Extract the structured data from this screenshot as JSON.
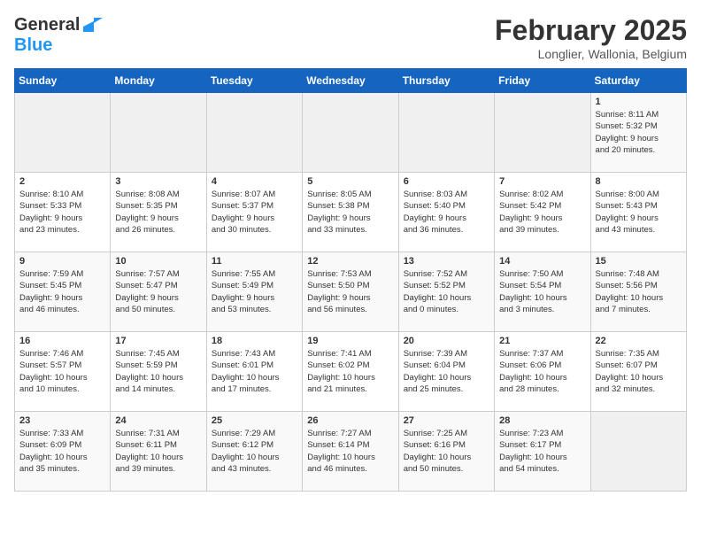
{
  "header": {
    "logo": {
      "general": "General",
      "blue": "Blue"
    },
    "title": "February 2025",
    "location": "Longlier, Wallonia, Belgium"
  },
  "weekdays": [
    "Sunday",
    "Monday",
    "Tuesday",
    "Wednesday",
    "Thursday",
    "Friday",
    "Saturday"
  ],
  "weeks": [
    [
      {
        "day": "",
        "info": ""
      },
      {
        "day": "",
        "info": ""
      },
      {
        "day": "",
        "info": ""
      },
      {
        "day": "",
        "info": ""
      },
      {
        "day": "",
        "info": ""
      },
      {
        "day": "",
        "info": ""
      },
      {
        "day": "1",
        "info": "Sunrise: 8:11 AM\nSunset: 5:32 PM\nDaylight: 9 hours\nand 20 minutes."
      }
    ],
    [
      {
        "day": "2",
        "info": "Sunrise: 8:10 AM\nSunset: 5:33 PM\nDaylight: 9 hours\nand 23 minutes."
      },
      {
        "day": "3",
        "info": "Sunrise: 8:08 AM\nSunset: 5:35 PM\nDaylight: 9 hours\nand 26 minutes."
      },
      {
        "day": "4",
        "info": "Sunrise: 8:07 AM\nSunset: 5:37 PM\nDaylight: 9 hours\nand 30 minutes."
      },
      {
        "day": "5",
        "info": "Sunrise: 8:05 AM\nSunset: 5:38 PM\nDaylight: 9 hours\nand 33 minutes."
      },
      {
        "day": "6",
        "info": "Sunrise: 8:03 AM\nSunset: 5:40 PM\nDaylight: 9 hours\nand 36 minutes."
      },
      {
        "day": "7",
        "info": "Sunrise: 8:02 AM\nSunset: 5:42 PM\nDaylight: 9 hours\nand 39 minutes."
      },
      {
        "day": "8",
        "info": "Sunrise: 8:00 AM\nSunset: 5:43 PM\nDaylight: 9 hours\nand 43 minutes."
      }
    ],
    [
      {
        "day": "9",
        "info": "Sunrise: 7:59 AM\nSunset: 5:45 PM\nDaylight: 9 hours\nand 46 minutes."
      },
      {
        "day": "10",
        "info": "Sunrise: 7:57 AM\nSunset: 5:47 PM\nDaylight: 9 hours\nand 50 minutes."
      },
      {
        "day": "11",
        "info": "Sunrise: 7:55 AM\nSunset: 5:49 PM\nDaylight: 9 hours\nand 53 minutes."
      },
      {
        "day": "12",
        "info": "Sunrise: 7:53 AM\nSunset: 5:50 PM\nDaylight: 9 hours\nand 56 minutes."
      },
      {
        "day": "13",
        "info": "Sunrise: 7:52 AM\nSunset: 5:52 PM\nDaylight: 10 hours\nand 0 minutes."
      },
      {
        "day": "14",
        "info": "Sunrise: 7:50 AM\nSunset: 5:54 PM\nDaylight: 10 hours\nand 3 minutes."
      },
      {
        "day": "15",
        "info": "Sunrise: 7:48 AM\nSunset: 5:56 PM\nDaylight: 10 hours\nand 7 minutes."
      }
    ],
    [
      {
        "day": "16",
        "info": "Sunrise: 7:46 AM\nSunset: 5:57 PM\nDaylight: 10 hours\nand 10 minutes."
      },
      {
        "day": "17",
        "info": "Sunrise: 7:45 AM\nSunset: 5:59 PM\nDaylight: 10 hours\nand 14 minutes."
      },
      {
        "day": "18",
        "info": "Sunrise: 7:43 AM\nSunset: 6:01 PM\nDaylight: 10 hours\nand 17 minutes."
      },
      {
        "day": "19",
        "info": "Sunrise: 7:41 AM\nSunset: 6:02 PM\nDaylight: 10 hours\nand 21 minutes."
      },
      {
        "day": "20",
        "info": "Sunrise: 7:39 AM\nSunset: 6:04 PM\nDaylight: 10 hours\nand 25 minutes."
      },
      {
        "day": "21",
        "info": "Sunrise: 7:37 AM\nSunset: 6:06 PM\nDaylight: 10 hours\nand 28 minutes."
      },
      {
        "day": "22",
        "info": "Sunrise: 7:35 AM\nSunset: 6:07 PM\nDaylight: 10 hours\nand 32 minutes."
      }
    ],
    [
      {
        "day": "23",
        "info": "Sunrise: 7:33 AM\nSunset: 6:09 PM\nDaylight: 10 hours\nand 35 minutes."
      },
      {
        "day": "24",
        "info": "Sunrise: 7:31 AM\nSunset: 6:11 PM\nDaylight: 10 hours\nand 39 minutes."
      },
      {
        "day": "25",
        "info": "Sunrise: 7:29 AM\nSunset: 6:12 PM\nDaylight: 10 hours\nand 43 minutes."
      },
      {
        "day": "26",
        "info": "Sunrise: 7:27 AM\nSunset: 6:14 PM\nDaylight: 10 hours\nand 46 minutes."
      },
      {
        "day": "27",
        "info": "Sunrise: 7:25 AM\nSunset: 6:16 PM\nDaylight: 10 hours\nand 50 minutes."
      },
      {
        "day": "28",
        "info": "Sunrise: 7:23 AM\nSunset: 6:17 PM\nDaylight: 10 hours\nand 54 minutes."
      },
      {
        "day": "",
        "info": ""
      }
    ]
  ]
}
